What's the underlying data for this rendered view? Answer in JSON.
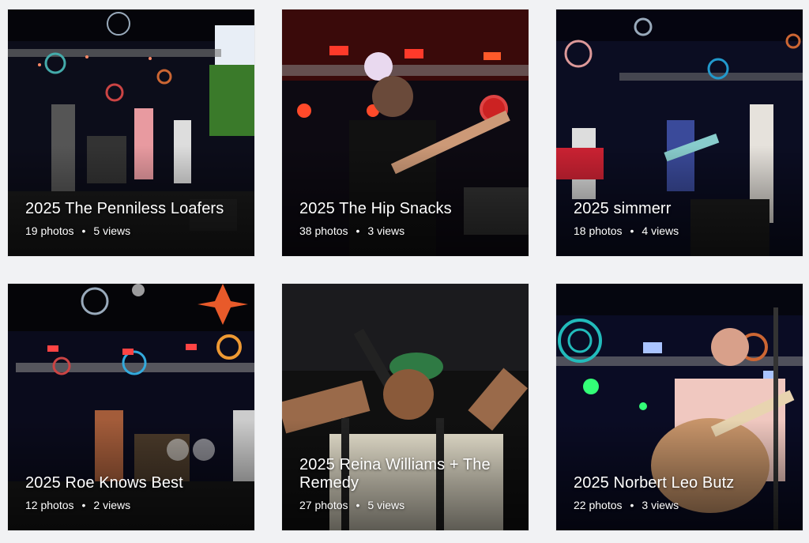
{
  "albums": [
    {
      "title": "2025 The Penniless Loafers",
      "photos": "19 photos",
      "separator": "•",
      "views": "5 views"
    },
    {
      "title": "2025 The Hip Snacks",
      "photos": "38 photos",
      "separator": "•",
      "views": "3 views"
    },
    {
      "title": "2025 simmerr",
      "photos": "18 photos",
      "separator": "•",
      "views": "4 views"
    },
    {
      "title": "2025 Roe Knows Best",
      "photos": "12 photos",
      "separator": "•",
      "views": "2 views"
    },
    {
      "title": "2025 Reina Williams + The Remedy",
      "photos": "27 photos",
      "separator": "•",
      "views": "5 views"
    },
    {
      "title": "2025 Norbert Leo Butz",
      "photos": "22 photos",
      "separator": "•",
      "views": "3 views"
    }
  ],
  "colors": {
    "page_background": "#f1f2f4",
    "caption_text": "#ffffff"
  }
}
